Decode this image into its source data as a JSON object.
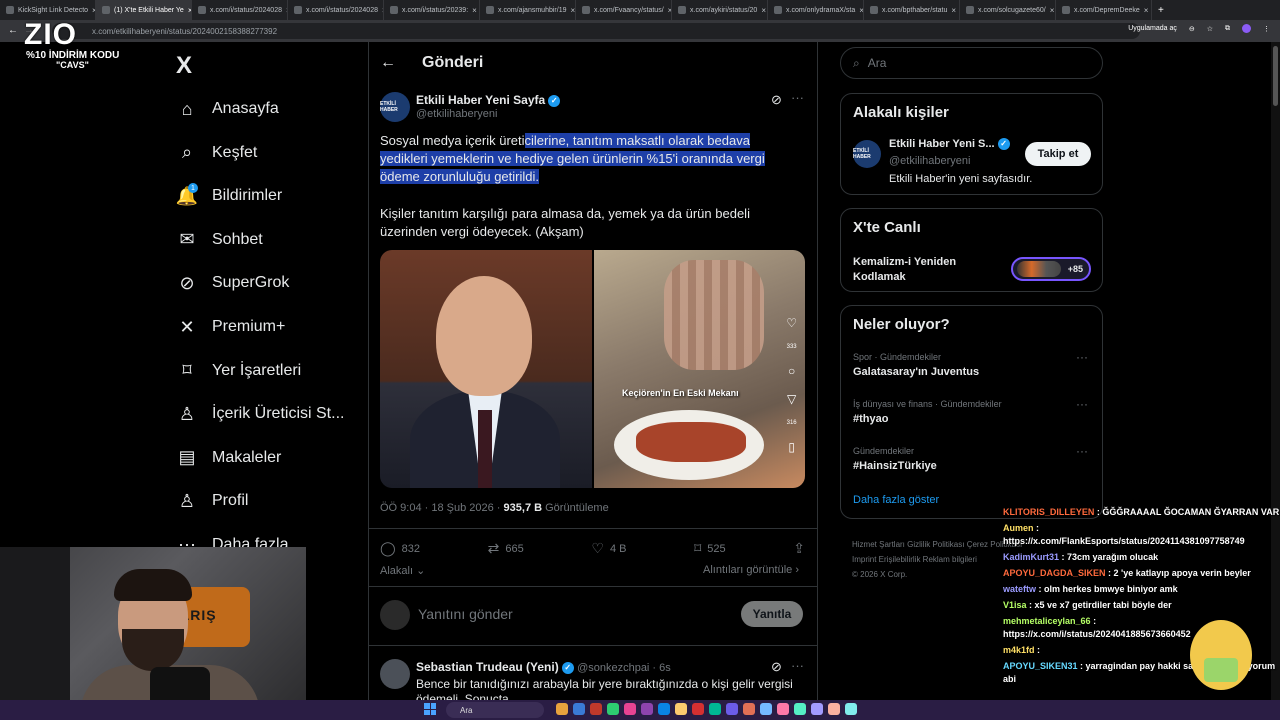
{
  "browser": {
    "tabs": [
      {
        "label": "KickSight Link Detecto",
        "active": false
      },
      {
        "label": "(1) X'te Etkili Haber Ye",
        "active": true
      },
      {
        "label": "x.com/i/status/2024028",
        "active": false
      },
      {
        "label": "x.com/i/status/2024028",
        "active": false
      },
      {
        "label": "x.com/i/status/20239:",
        "active": false
      },
      {
        "label": "x.com/ajansmuhbir/19",
        "active": false
      },
      {
        "label": "x.com/Fvaancy/status/",
        "active": false
      },
      {
        "label": "x.com/aykiri/status/20",
        "active": false
      },
      {
        "label": "x.com/onlydramaX/sta",
        "active": false
      },
      {
        "label": "x.com/bpthaber/statu",
        "active": false
      },
      {
        "label": "x.com/solcugazete60/",
        "active": false
      },
      {
        "label": "x.com/DepremDeeke",
        "active": false
      }
    ],
    "url": "x.com/etkilihaberyeni/status/2024002158388277392",
    "app_mode_label": "Uygulamada aç"
  },
  "overlay": {
    "logo_text": "ZIO",
    "promo_line": "%10 İNDİRİM KODU",
    "promo_code": "\"CAVS\""
  },
  "sidebar": {
    "logo": "X",
    "items": [
      {
        "label": "Anasayfa",
        "icon": "home-icon"
      },
      {
        "label": "Keşfet",
        "icon": "search-icon"
      },
      {
        "label": "Bildirimler",
        "icon": "bell-icon",
        "badge": "1"
      },
      {
        "label": "Sohbet",
        "icon": "mail-icon"
      },
      {
        "label": "SuperGrok",
        "icon": "grok-icon"
      },
      {
        "label": "Premium+",
        "icon": "x-icon"
      },
      {
        "label": "Yer İşaretleri",
        "icon": "bookmark-icon"
      },
      {
        "label": "İçerik Üreticisi St...",
        "icon": "creator-icon"
      },
      {
        "label": "Makaleler",
        "icon": "article-icon"
      },
      {
        "label": "Profil",
        "icon": "profile-icon"
      },
      {
        "label": "Daha fazla",
        "icon": "more-icon"
      }
    ]
  },
  "post": {
    "header_title": "Gönderi",
    "author_name": "Etkili Haber Yeni Sayfa",
    "author_handle": "@etkilihaberyeni",
    "avatar_text": "ETKİLİ HABER",
    "text_plain": "Sosyal medya içerik üreti",
    "text_highlight": "cilerine, tanıtım maksatlı olarak bedava yedikleri yemeklerin ve hediye gelen ürünlerin %15'i oranında vergi ödeme zorunluluğu getirildi.",
    "text_2": "Kişiler tanıtım karşılığı para almasa da, yemek ya da ürün bedeli üzerinden vergi ödeyecek. (Akşam)",
    "media_caption": "Keçiören'in En Eski Mekanı",
    "media_like_count": "333",
    "media_share_count": "316",
    "time": "ÖÖ 9:04 · 18 Şub 2026 ·",
    "views": "935,7 B",
    "views_label": "Görüntüleme",
    "replies": "832",
    "reposts": "665",
    "likes": "4 B",
    "bookmarks": "525",
    "sub_left": "Alakalı",
    "sub_right": "Alıntıları görüntüle",
    "reply_placeholder": "Yanıtını gönder",
    "reply_button": "Yanıtla"
  },
  "comment": {
    "author_name": "Sebastian Trudeau (Yeni)",
    "author_handle": "@sonkezchpai · 6s",
    "text": "Bence bir tanıdığınızı arabayla bir yere bıraktığınızda o kişi gelir vergisi ödemeli. Sonuçta..."
  },
  "right": {
    "search_placeholder": "Ara",
    "related_title": "Alakalı kişiler",
    "related_name": "Etkili Haber Yeni S...",
    "related_handle": "@etkilihaberyeni",
    "related_bio": "Etkili Haber'in yeni sayfasıdır.",
    "follow_label": "Takip et",
    "live_title": "X'te Canlı",
    "live_topic": "Kemalizm-i Yeniden Kodlamak",
    "live_count": "+85",
    "trends_title": "Neler oluyor?",
    "trends": [
      {
        "category": "Spor · Gündemdekiler",
        "tag": "Galatasaray'ın Juventus"
      },
      {
        "category": "İş dünyası ve finans · Gündemdekiler",
        "tag": "#thyao"
      },
      {
        "category": "Gündemdekiler",
        "tag": "#HainsizTürkiye"
      }
    ],
    "show_more": "Daha fazla göster",
    "footer_1": "Hizmet Şartları   Gizlilik Politikası   Çerez Politikası",
    "footer_2": "Imprint   Erişilebilirlik   Reklam bilgileri",
    "footer_3": "© 2026 X Corp."
  },
  "webcam": {
    "jersey_text": "BARIŞ"
  },
  "chat": [
    {
      "user": "KLITORIS_DILLEYEN",
      "text": ": ĞĞĞRAAAAL ĞOCAMAN ĞYARRAN VAR"
    },
    {
      "user": "Aumen",
      "text": ": https://x.com/FlankEsports/status/2024114381097758749"
    },
    {
      "user": "KadimKurt31",
      "text": ": 73cm yarağım olucak"
    },
    {
      "user": "APOYU_DAGDA_SIKEN",
      "text": ": 2 'ye katlayıp apoya verin beyler"
    },
    {
      "user": "wateftw",
      "text": ": olm herkes bmwye biniyor amk"
    },
    {
      "user": "V1isa",
      "text": ": x5 ve x7 getirdiler tabi böyle der"
    },
    {
      "user": "mehmetaliceylan_66",
      "text": ": https://x.com/i/status/2024041885673660452"
    },
    {
      "user": "m4k1fd",
      "text": ":"
    },
    {
      "user": "APOYU_SIKEN31",
      "text": ": yarragindan pay hakki satin almak istiyorum abi"
    }
  ],
  "taskbar": {
    "search_label": "Ara"
  }
}
